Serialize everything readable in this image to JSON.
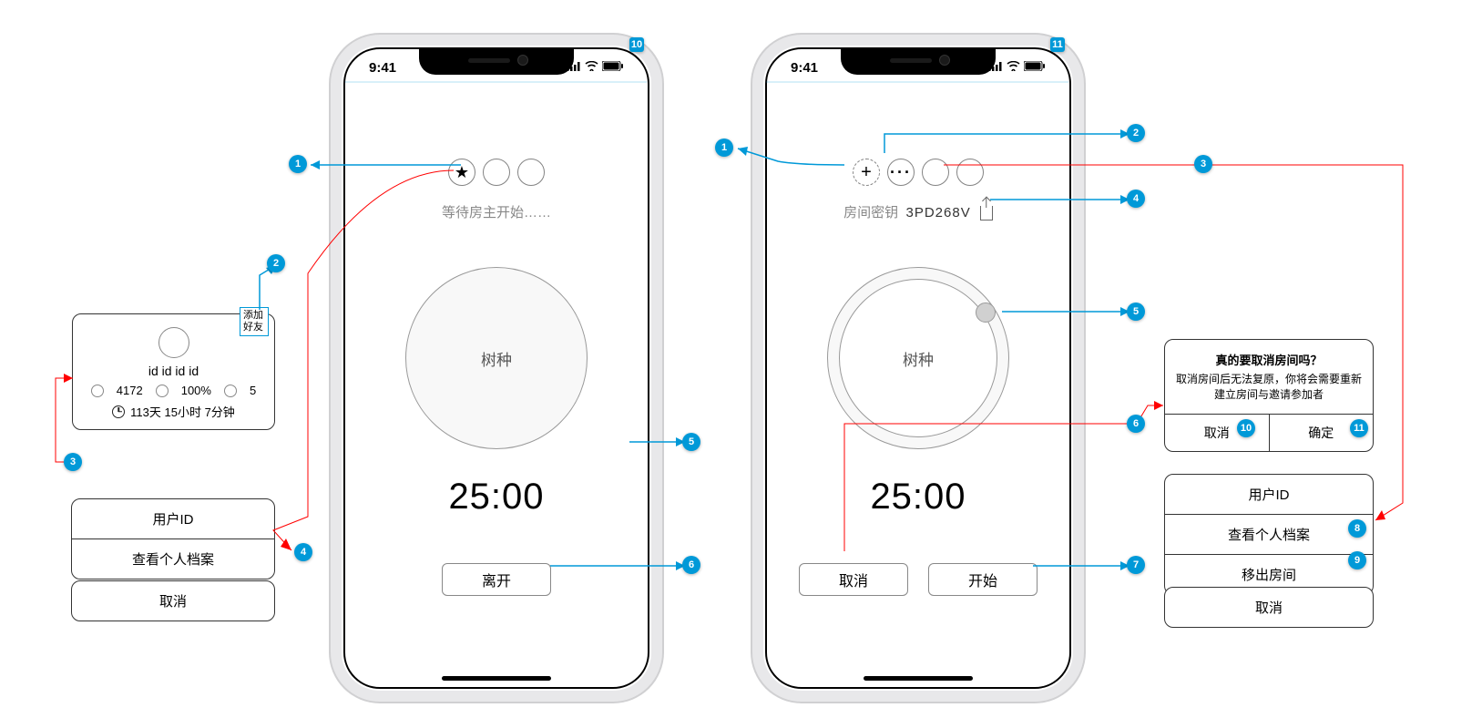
{
  "status": {
    "time": "9:41"
  },
  "phone1": {
    "avatars_hint": "★",
    "wait_text": "等待房主开始……",
    "tree_label": "树种",
    "timer": "25:00",
    "leave_btn": "离开"
  },
  "phone2": {
    "plus": "+",
    "dots": "···",
    "key_label": "房间密钥",
    "key_value": "3PD268V",
    "tree_label": "树种",
    "timer": "25:00",
    "cancel_btn": "取消",
    "start_btn": "开始"
  },
  "left_card": {
    "id_line": "id id id id",
    "stat1": "4172",
    "stat2": "100%",
    "stat3": "5",
    "time_line": "113天 15小时 7分钟",
    "add_friend": "添加好友"
  },
  "left_menu": {
    "title": "用户ID",
    "view_profile": "查看个人档案",
    "cancel": "取消"
  },
  "dialog": {
    "title": "真的要取消房间吗？",
    "body": "取消房间后无法复原，你将会需要重新建立房间与邀请参加者",
    "cancel": "取消",
    "confirm": "确定"
  },
  "right_menu": {
    "title": "用户ID",
    "view_profile": "查看个人档案",
    "remove": "移出房间",
    "cancel": "取消"
  },
  "frame_badge1": "10",
  "frame_badge2": "11",
  "annotations_left": [
    "1",
    "2",
    "3",
    "4",
    "5",
    "6"
  ],
  "annotations_right": [
    "1",
    "2",
    "3",
    "4",
    "5",
    "6",
    "7",
    "8",
    "9",
    "10",
    "11"
  ]
}
